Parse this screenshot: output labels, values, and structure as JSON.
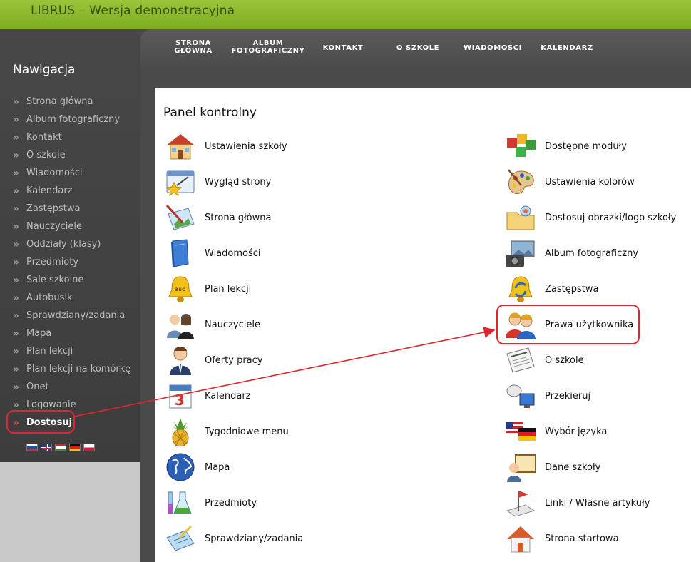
{
  "header": {
    "title": "LIBRUS – Wersja demonstracyjna"
  },
  "menu": [
    {
      "label": "STRONA\nGŁÓWNA"
    },
    {
      "label": "ALBUM\nFOTOGRAFICZNY"
    },
    {
      "label": "KONTAKT"
    },
    {
      "label": "O SZKOLE"
    },
    {
      "label": "WIADOMOŚCI"
    },
    {
      "label": "KALENDARZ"
    }
  ],
  "sidebar": {
    "heading": "Nawigacja",
    "items": [
      {
        "label": "Strona główna"
      },
      {
        "label": "Album fotograficzny"
      },
      {
        "label": "Kontakt"
      },
      {
        "label": "O szkole"
      },
      {
        "label": "Wiadomości"
      },
      {
        "label": "Kalendarz"
      },
      {
        "label": "Zastępstwa"
      },
      {
        "label": "Nauczyciele"
      },
      {
        "label": "Oddziały (klasy)"
      },
      {
        "label": "Przedmioty"
      },
      {
        "label": "Sale szkolne"
      },
      {
        "label": "Autobusik"
      },
      {
        "label": "Sprawdziany/zadania"
      },
      {
        "label": "Mapa"
      },
      {
        "label": "Plan lekcji"
      },
      {
        "label": "Plan lekcji na komórkę"
      },
      {
        "label": "Onet"
      },
      {
        "label": "Logowanie"
      },
      {
        "label": "Dostosuj",
        "active": true
      }
    ],
    "languages": [
      "sk",
      "en",
      "hu",
      "de",
      "pl"
    ]
  },
  "panel": {
    "title": "Panel kontrolny",
    "left": [
      {
        "label": "Ustawienia szkoły",
        "icon": "house-icon"
      },
      {
        "label": "Wygląd strony",
        "icon": "window-wand-icon"
      },
      {
        "label": "Strona główna",
        "icon": "picture-pencil-icon"
      },
      {
        "label": "Wiadomości",
        "icon": "book-icon"
      },
      {
        "label": "Plan lekcji",
        "icon": "bell-icon"
      },
      {
        "label": "Nauczyciele",
        "icon": "people-icon"
      },
      {
        "label": "Oferty pracy",
        "icon": "businessman-icon"
      },
      {
        "label": "Kalendarz",
        "icon": "calendar-icon"
      },
      {
        "label": "Tygodniowe menu",
        "icon": "pineapple-icon"
      },
      {
        "label": "Mapa",
        "icon": "globe-icon"
      },
      {
        "label": "Przedmioty",
        "icon": "lab-flask-icon"
      },
      {
        "label": "Sprawdziany/zadania",
        "icon": "document-pencil-icon"
      }
    ],
    "right": [
      {
        "label": "Dostępne moduły",
        "icon": "cubes-icon"
      },
      {
        "label": "Ustawienia kolorów",
        "icon": "palette-icon"
      },
      {
        "label": "Dostosuj obrazki/logo szkoły",
        "icon": "image-folder-icon"
      },
      {
        "label": "Album fotograficzny",
        "icon": "camera-icon"
      },
      {
        "label": "Zastępstwa",
        "icon": "bell-swap-icon"
      },
      {
        "label": "Prawa użytkownika",
        "icon": "users-icon",
        "highlighted": true
      },
      {
        "label": "O szkole",
        "icon": "newspaper-icon"
      },
      {
        "label": "Przekieruj",
        "icon": "satellite-icon"
      },
      {
        "label": "Wybór języka",
        "icon": "flags-icon"
      },
      {
        "label": "Dane szkoły",
        "icon": "certificate-icon"
      },
      {
        "label": "Linki / Własne artykuły",
        "icon": "flag-link-icon"
      },
      {
        "label": "Strona startowa",
        "icon": "home-start-icon"
      }
    ]
  },
  "colors": {
    "accent_green": "#8cb82e",
    "annotation_red": "#e0262c",
    "dark_bg": "#4a4a4a"
  }
}
